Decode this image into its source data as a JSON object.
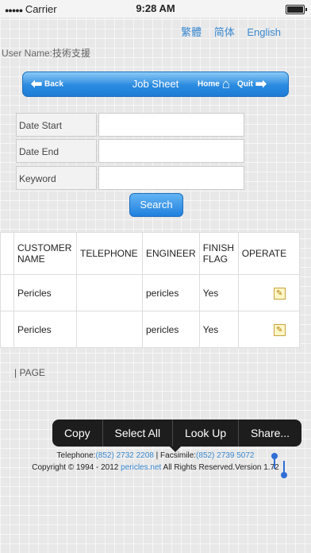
{
  "status": {
    "carrier": "Carrier",
    "time": "9:28 AM"
  },
  "lang": {
    "trad": "繁體",
    "simp": "简体",
    "eng": "English"
  },
  "user": {
    "text": "User Name:技術支援"
  },
  "nav": {
    "back": "Back",
    "title": "Job Sheet",
    "home": "Home",
    "quit": "Quit"
  },
  "form": {
    "date_start": "Date Start",
    "date_end": "Date End",
    "keyword": "Keyword",
    "search": "Search"
  },
  "table": {
    "headers": [
      "CUSTOMER NAME",
      "TELEPHONE",
      "ENGINEER",
      "FINISH FLAG",
      "OPERATE"
    ],
    "rows": [
      {
        "name": "Pericles",
        "tel": "",
        "eng": "pericles",
        "flag": "Yes"
      },
      {
        "name": "Pericles",
        "tel": "",
        "eng": "pericles",
        "flag": "Yes"
      }
    ]
  },
  "page": {
    "label": "PAGE"
  },
  "footer": {
    "tel_label": "Telephone:",
    "tel": "(852) 2732 2208",
    "sep": " | ",
    "fax_label": "Facsimile:",
    "fax": "(852) 2739 5072",
    "copy_pre": "Copyright © 1994 - 2012 ",
    "site": "pericles.net",
    "copy_post": " All Rights Reserved.Version 1.72"
  },
  "menu": {
    "copy": "Copy",
    "select_all": "Select All",
    "look_up": "Look Up",
    "share": "Share..."
  }
}
